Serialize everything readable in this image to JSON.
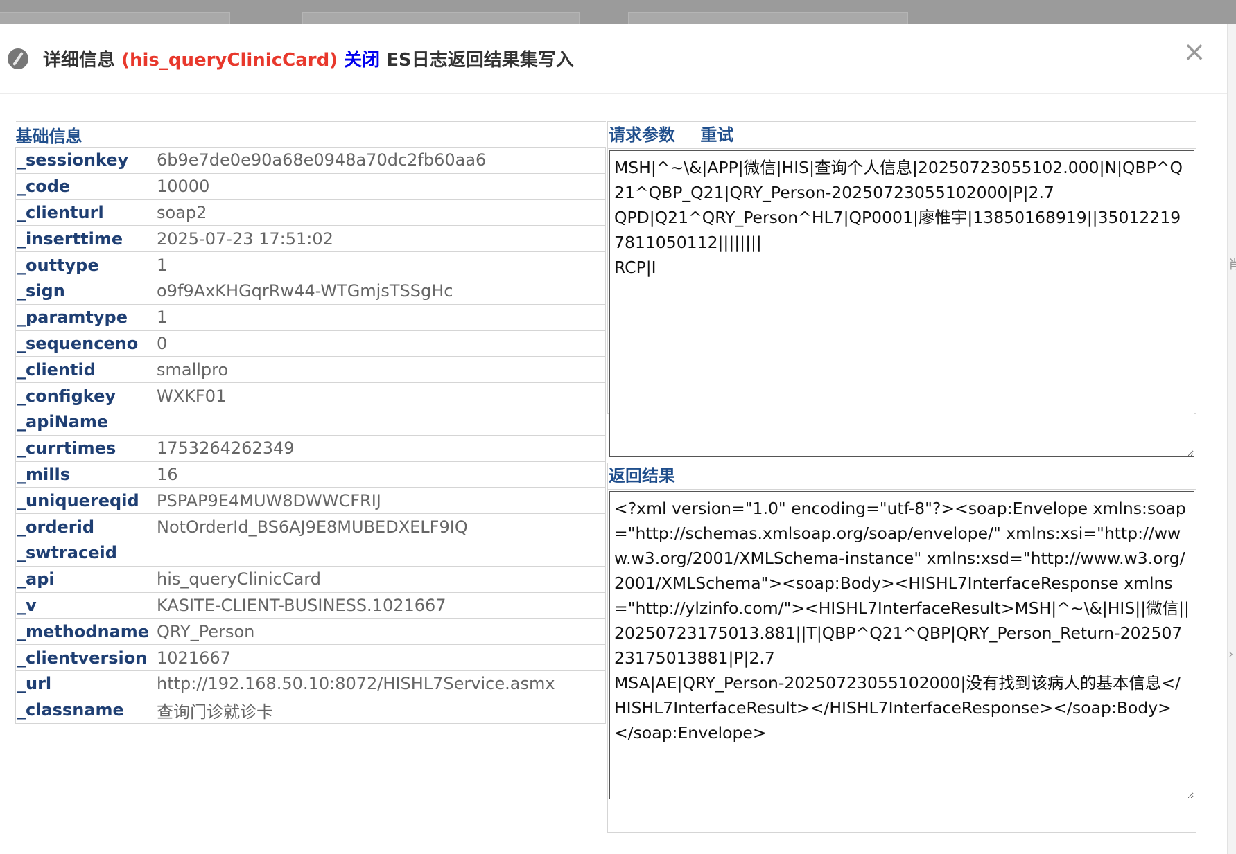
{
  "modal": {
    "title_prefix": "详细信息",
    "api_name": "(his_queryClinicCard)",
    "close_link": "关闭",
    "title_suffix": "ES日志返回结果集写入",
    "close_x": "×"
  },
  "basic_info": {
    "section_title": "基础信息",
    "rows": [
      {
        "key": "_sessionkey",
        "value": "6b9e7de0e90a68e0948a70dc2fb60aa6"
      },
      {
        "key": "_code",
        "value": "10000"
      },
      {
        "key": "_clienturl",
        "value": "soap2"
      },
      {
        "key": "_inserttime",
        "value": "2025-07-23 17:51:02"
      },
      {
        "key": "_outtype",
        "value": "1"
      },
      {
        "key": "_sign",
        "value": "o9f9AxKHGqrRw44-WTGmjsTSSgHc"
      },
      {
        "key": "_paramtype",
        "value": "1"
      },
      {
        "key": "_sequenceno",
        "value": "0"
      },
      {
        "key": "_clientid",
        "value": "smallpro"
      },
      {
        "key": "_configkey",
        "value": "WXKF01"
      },
      {
        "key": "_apiName",
        "value": ""
      },
      {
        "key": "_currtimes",
        "value": "1753264262349"
      },
      {
        "key": "_mills",
        "value": "16"
      },
      {
        "key": "_uniquereqid",
        "value": "PSPAP9E4MUW8DWWCFRIJ"
      },
      {
        "key": "_orderid",
        "value": "NotOrderId_BS6AJ9E8MUBEDXELF9IQ"
      },
      {
        "key": "_swtraceid",
        "value": ""
      },
      {
        "key": "_api",
        "value": "his_queryClinicCard"
      },
      {
        "key": "_v",
        "value": "KASITE-CLIENT-BUSINESS.1021667"
      },
      {
        "key": "_methodname",
        "value": "QRY_Person"
      },
      {
        "key": "_clientversion",
        "value": "1021667"
      },
      {
        "key": "_url",
        "value": "http://192.168.50.10:8072/HISHL7Service.asmx"
      },
      {
        "key": "_classname",
        "value": "查询门诊就诊卡"
      }
    ]
  },
  "request": {
    "label": "请求参数",
    "retry_label": "重试",
    "content": "MSH|^~\\&|APP|微信|HIS|查询个人信息|20250723055102.000|N|QBP^Q21^QBP_Q21|QRY_Person-20250723055102000|P|2.7\nQPD|Q21^QRY_Person^HL7|QP0001|廖惟宇|13850168919||350122197811050112||||||||\nRCP|I"
  },
  "response": {
    "label": "返回结果",
    "content": "<?xml version=\"1.0\" encoding=\"utf-8\"?><soap:Envelope xmlns:soap=\"http://schemas.xmlsoap.org/soap/envelope/\" xmlns:xsi=\"http://www.w3.org/2001/XMLSchema-instance\" xmlns:xsd=\"http://www.w3.org/2001/XMLSchema\"><soap:Body><HISHL7InterfaceResponse xmlns=\"http://ylzinfo.com/\"><HISHL7InterfaceResult>MSH|^~\\&|HIS||微信||20250723175013.881||T|QBP^Q21^QBP|QRY_Person_Return-20250723175013881|P|2.7\nMSA|AE|QRY_Person-20250723055102000|没有找到该病人的基本信息</HISHL7InterfaceResult></HISHL7InterfaceResponse></soap:Body></soap:Envelope>"
  },
  "side_glyphs": [
    "肖",
    "›"
  ]
}
